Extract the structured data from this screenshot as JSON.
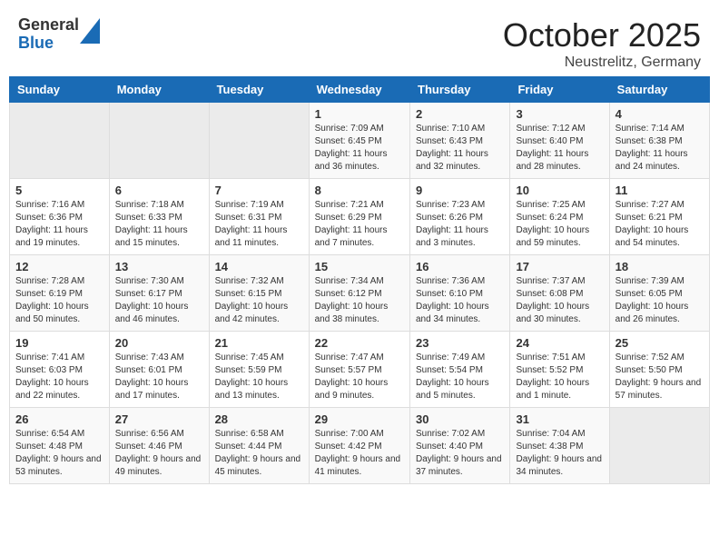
{
  "header": {
    "logo_general": "General",
    "logo_blue": "Blue",
    "month_title": "October 2025",
    "location": "Neustrelitz, Germany"
  },
  "days_of_week": [
    "Sunday",
    "Monday",
    "Tuesday",
    "Wednesday",
    "Thursday",
    "Friday",
    "Saturday"
  ],
  "weeks": [
    {
      "days": [
        {
          "number": "",
          "info": ""
        },
        {
          "number": "",
          "info": ""
        },
        {
          "number": "",
          "info": ""
        },
        {
          "number": "1",
          "info": "Sunrise: 7:09 AM\nSunset: 6:45 PM\nDaylight: 11 hours and 36 minutes."
        },
        {
          "number": "2",
          "info": "Sunrise: 7:10 AM\nSunset: 6:43 PM\nDaylight: 11 hours and 32 minutes."
        },
        {
          "number": "3",
          "info": "Sunrise: 7:12 AM\nSunset: 6:40 PM\nDaylight: 11 hours and 28 minutes."
        },
        {
          "number": "4",
          "info": "Sunrise: 7:14 AM\nSunset: 6:38 PM\nDaylight: 11 hours and 24 minutes."
        }
      ]
    },
    {
      "days": [
        {
          "number": "5",
          "info": "Sunrise: 7:16 AM\nSunset: 6:36 PM\nDaylight: 11 hours and 19 minutes."
        },
        {
          "number": "6",
          "info": "Sunrise: 7:18 AM\nSunset: 6:33 PM\nDaylight: 11 hours and 15 minutes."
        },
        {
          "number": "7",
          "info": "Sunrise: 7:19 AM\nSunset: 6:31 PM\nDaylight: 11 hours and 11 minutes."
        },
        {
          "number": "8",
          "info": "Sunrise: 7:21 AM\nSunset: 6:29 PM\nDaylight: 11 hours and 7 minutes."
        },
        {
          "number": "9",
          "info": "Sunrise: 7:23 AM\nSunset: 6:26 PM\nDaylight: 11 hours and 3 minutes."
        },
        {
          "number": "10",
          "info": "Sunrise: 7:25 AM\nSunset: 6:24 PM\nDaylight: 10 hours and 59 minutes."
        },
        {
          "number": "11",
          "info": "Sunrise: 7:27 AM\nSunset: 6:21 PM\nDaylight: 10 hours and 54 minutes."
        }
      ]
    },
    {
      "days": [
        {
          "number": "12",
          "info": "Sunrise: 7:28 AM\nSunset: 6:19 PM\nDaylight: 10 hours and 50 minutes."
        },
        {
          "number": "13",
          "info": "Sunrise: 7:30 AM\nSunset: 6:17 PM\nDaylight: 10 hours and 46 minutes."
        },
        {
          "number": "14",
          "info": "Sunrise: 7:32 AM\nSunset: 6:15 PM\nDaylight: 10 hours and 42 minutes."
        },
        {
          "number": "15",
          "info": "Sunrise: 7:34 AM\nSunset: 6:12 PM\nDaylight: 10 hours and 38 minutes."
        },
        {
          "number": "16",
          "info": "Sunrise: 7:36 AM\nSunset: 6:10 PM\nDaylight: 10 hours and 34 minutes."
        },
        {
          "number": "17",
          "info": "Sunrise: 7:37 AM\nSunset: 6:08 PM\nDaylight: 10 hours and 30 minutes."
        },
        {
          "number": "18",
          "info": "Sunrise: 7:39 AM\nSunset: 6:05 PM\nDaylight: 10 hours and 26 minutes."
        }
      ]
    },
    {
      "days": [
        {
          "number": "19",
          "info": "Sunrise: 7:41 AM\nSunset: 6:03 PM\nDaylight: 10 hours and 22 minutes."
        },
        {
          "number": "20",
          "info": "Sunrise: 7:43 AM\nSunset: 6:01 PM\nDaylight: 10 hours and 17 minutes."
        },
        {
          "number": "21",
          "info": "Sunrise: 7:45 AM\nSunset: 5:59 PM\nDaylight: 10 hours and 13 minutes."
        },
        {
          "number": "22",
          "info": "Sunrise: 7:47 AM\nSunset: 5:57 PM\nDaylight: 10 hours and 9 minutes."
        },
        {
          "number": "23",
          "info": "Sunrise: 7:49 AM\nSunset: 5:54 PM\nDaylight: 10 hours and 5 minutes."
        },
        {
          "number": "24",
          "info": "Sunrise: 7:51 AM\nSunset: 5:52 PM\nDaylight: 10 hours and 1 minute."
        },
        {
          "number": "25",
          "info": "Sunrise: 7:52 AM\nSunset: 5:50 PM\nDaylight: 9 hours and 57 minutes."
        }
      ]
    },
    {
      "days": [
        {
          "number": "26",
          "info": "Sunrise: 6:54 AM\nSunset: 4:48 PM\nDaylight: 9 hours and 53 minutes."
        },
        {
          "number": "27",
          "info": "Sunrise: 6:56 AM\nSunset: 4:46 PM\nDaylight: 9 hours and 49 minutes."
        },
        {
          "number": "28",
          "info": "Sunrise: 6:58 AM\nSunset: 4:44 PM\nDaylight: 9 hours and 45 minutes."
        },
        {
          "number": "29",
          "info": "Sunrise: 7:00 AM\nSunset: 4:42 PM\nDaylight: 9 hours and 41 minutes."
        },
        {
          "number": "30",
          "info": "Sunrise: 7:02 AM\nSunset: 4:40 PM\nDaylight: 9 hours and 37 minutes."
        },
        {
          "number": "31",
          "info": "Sunrise: 7:04 AM\nSunset: 4:38 PM\nDaylight: 9 hours and 34 minutes."
        },
        {
          "number": "",
          "info": ""
        }
      ]
    }
  ]
}
